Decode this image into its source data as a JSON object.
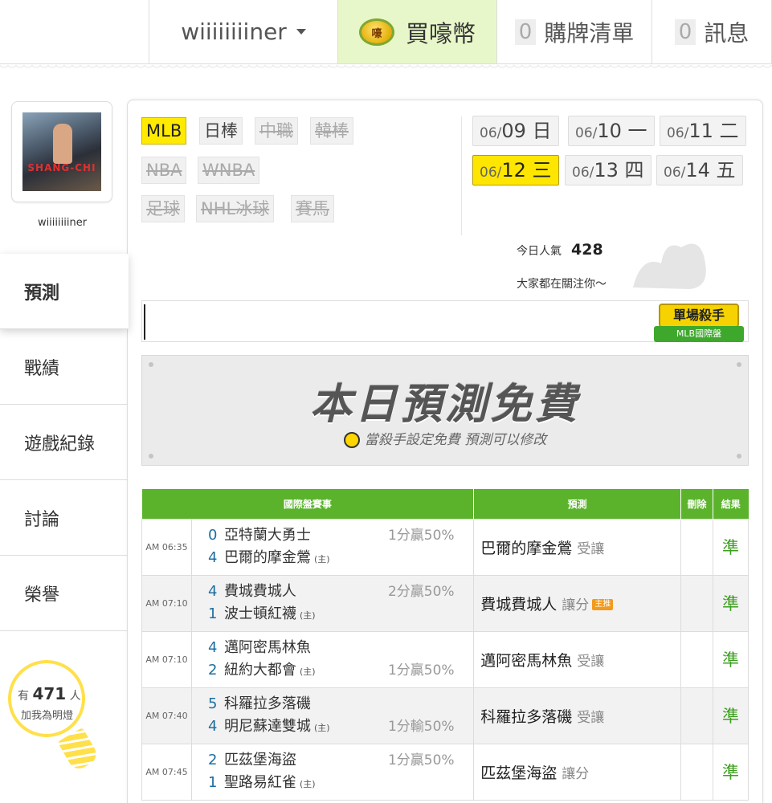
{
  "topbar": {
    "username": "wiiiiiiiiner",
    "coin_label": "買嚎幣",
    "coin_icon_text": "嚎",
    "cart_count": "0",
    "cart_label": "購牌清單",
    "message_count": "0",
    "message_label": "訊息"
  },
  "sidebar": {
    "username": "wiiiiiiiiner",
    "avatar_text": "SHANG-CHI",
    "nav": [
      {
        "label": "預測",
        "active": true
      },
      {
        "label": "戰績"
      },
      {
        "label": "遊戲紀錄"
      },
      {
        "label": "討論"
      },
      {
        "label": "榮譽"
      }
    ],
    "bulb": {
      "prefix": "有",
      "count": "471",
      "suffix": "人",
      "line2": "加我為明燈"
    }
  },
  "leagues": [
    {
      "label": "MLB",
      "state": "on"
    },
    {
      "label": "日棒",
      "state": "plain"
    },
    {
      "label": "中職",
      "state": "off"
    },
    {
      "label": "韓棒",
      "state": "off"
    },
    {
      "label": "NBA",
      "state": "off"
    },
    {
      "label": "WNBA",
      "state": "off"
    },
    {
      "label": "足球",
      "state": "off"
    },
    {
      "label": "NHL冰球",
      "state": "off"
    },
    {
      "label": "賽馬",
      "state": "off"
    }
  ],
  "dates": [
    {
      "md": "06/",
      "day": "09",
      "wd": "日"
    },
    {
      "md": "06/",
      "day": "10",
      "wd": "一"
    },
    {
      "md": "06/",
      "day": "11",
      "wd": "二"
    },
    {
      "md": "06/",
      "day": "12",
      "wd": "三",
      "active": true
    },
    {
      "md": "06/",
      "day": "13",
      "wd": "四"
    },
    {
      "md": "06/",
      "day": "14",
      "wd": "五"
    }
  ],
  "popularity": {
    "label": "今日人氣",
    "value": "428",
    "subtitle": "大家都在關注你～"
  },
  "killer_badge": {
    "title": "單場殺手",
    "subtitle": "MLB國際盤"
  },
  "free_banner": {
    "title": "本日預測免費",
    "subtitle": "當殺手設定免費  預測可以修改"
  },
  "table": {
    "headers": {
      "game": "國際盤賽事",
      "prediction": "預測",
      "delete": "刪除",
      "result": "結果"
    },
    "host_mark": "(主)",
    "rows": [
      {
        "time": "AM 06:35",
        "away_score": "0",
        "away": "亞特蘭大勇士",
        "home_score": "4",
        "home": "巴爾的摩金鶯",
        "odds": "1分贏50%",
        "odds_row": "top",
        "pick": "巴爾的摩金鶯",
        "kind": "受讓",
        "badge": "",
        "result": "準"
      },
      {
        "time": "AM 07:10",
        "away_score": "4",
        "away": "費城費城人",
        "home_score": "1",
        "home": "波士頓紅襪",
        "odds": "2分贏50%",
        "odds_row": "top",
        "pick": "費城費城人",
        "kind": "讓分",
        "badge": "主推",
        "result": "準"
      },
      {
        "time": "AM 07:10",
        "away_score": "4",
        "away": "邁阿密馬林魚",
        "home_score": "2",
        "home": "紐約大都會",
        "odds": "1分贏50%",
        "odds_row": "bottom",
        "pick": "邁阿密馬林魚",
        "kind": "受讓",
        "badge": "",
        "result": "準"
      },
      {
        "time": "AM 07:40",
        "away_score": "5",
        "away": "科羅拉多落磯",
        "home_score": "4",
        "home": "明尼蘇達雙城",
        "odds": "1分輸50%",
        "odds_row": "bottom",
        "pick": "科羅拉多落磯",
        "kind": "受讓",
        "badge": "",
        "result": "準"
      },
      {
        "time": "AM 07:45",
        "away_score": "2",
        "away": "匹茲堡海盜",
        "home_score": "1",
        "home": "聖路易紅雀",
        "odds": "1分贏50%",
        "odds_row": "top",
        "pick": "匹茲堡海盜",
        "kind": "讓分",
        "badge": "",
        "result": "準"
      }
    ]
  }
}
